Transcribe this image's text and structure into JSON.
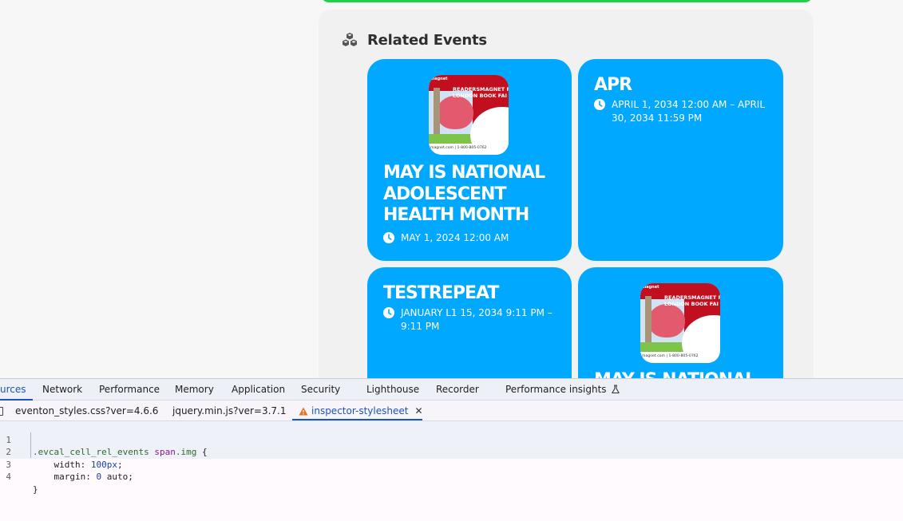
{
  "related_events": {
    "title": "Related Events",
    "icon": "cubes-icon",
    "cards": [
      {
        "title": "MAY IS NATIONAL ADOLESCENT HEALTH MONTH",
        "date": "MAY 1, 2024 12:00 AM",
        "thumb": {
          "brand_top": "magnet",
          "headline": "READERSMAGNET PRE\nLONDON BOOK FAI",
          "footer": "magnet.com | 1-800-805-0762"
        }
      },
      {
        "title": "APR",
        "date": "APRIL 1, 2034 12:00 AM – APRIL 30, 2034 11:59 PM"
      },
      {
        "title": "TESTREPEAT",
        "date": "JANUARY L1 15, 2034 9:11 PM – 9:11 PM"
      },
      {
        "title": "MAY IS NATIONAL",
        "thumb": {
          "brand_top": "magnet",
          "headline": "READERSMAGNET PRE\nLONDON BOOK FAI",
          "footer": "magnet.com | 1-800-805-0762"
        }
      }
    ],
    "colors": {
      "card": "#00a8ff",
      "accent_bar": "#1fd14a"
    }
  },
  "devtools": {
    "panel_tabs": [
      {
        "label": "urces",
        "active": true
      },
      {
        "label": "Network"
      },
      {
        "label": "Performance"
      },
      {
        "label": "Memory"
      },
      {
        "label": "Application"
      },
      {
        "label": "Security"
      },
      {
        "label": "Lighthouse"
      },
      {
        "label": "Recorder"
      },
      {
        "label": "Performance insights"
      }
    ],
    "file_tabs": [
      {
        "label": "eventon_styles.css?ver=4.6.6"
      },
      {
        "label": "jquery.min.js?ver=3.7.1"
      },
      {
        "label": "inspector-stylesheet",
        "active": true,
        "warning": true
      }
    ],
    "code": {
      "line_numbers": [
        "1",
        "2",
        "3",
        "4"
      ],
      "line1": {
        "selector": ".evcal_cell_rel_events",
        "tag": "span",
        "cls": ".img",
        "brace": " {"
      },
      "line2": {
        "prop": "    width: ",
        "value": "100px",
        "end": ";"
      },
      "line3": {
        "prop": "    margin: ",
        "value": "0",
        "rest": " auto;"
      },
      "line4": "}"
    }
  }
}
